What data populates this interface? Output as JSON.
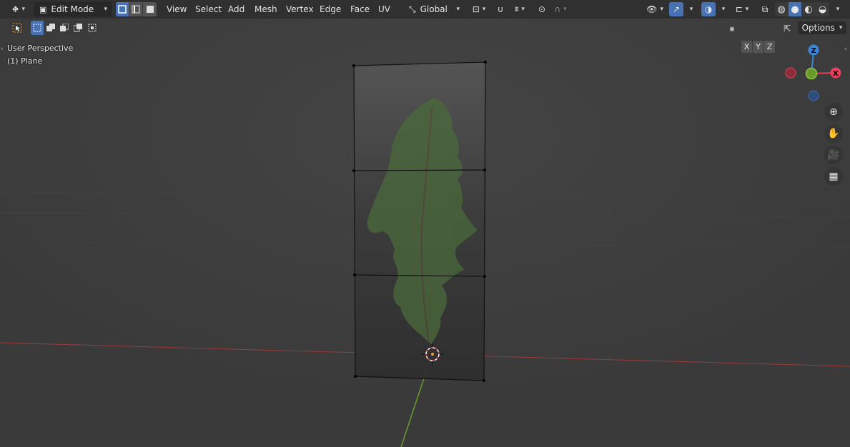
{
  "header": {
    "mode_label": "Edit Mode",
    "menus": [
      "View",
      "Select",
      "Add",
      "Mesh",
      "Vertex",
      "Edge",
      "Face",
      "UV"
    ],
    "orientation_label": "Global",
    "options_label": "Options"
  },
  "axis_lock": {
    "x": "X",
    "y": "Y",
    "z": "Z"
  },
  "overlay": {
    "view_name": "User Perspective",
    "object_name": "(1) Plane"
  },
  "gizmo": {
    "z": "Z",
    "x": "X"
  },
  "colors": {
    "accent": "#4772b3",
    "x_axis": "#e8405a",
    "y_axis": "#8ac33a",
    "z_axis": "#3a86d8"
  },
  "icons": {
    "editor_type": "editor-type-icon",
    "zoom": "zoom-icon",
    "pan": "hand-icon",
    "camera": "camera-icon",
    "perspective": "grid-icon"
  }
}
